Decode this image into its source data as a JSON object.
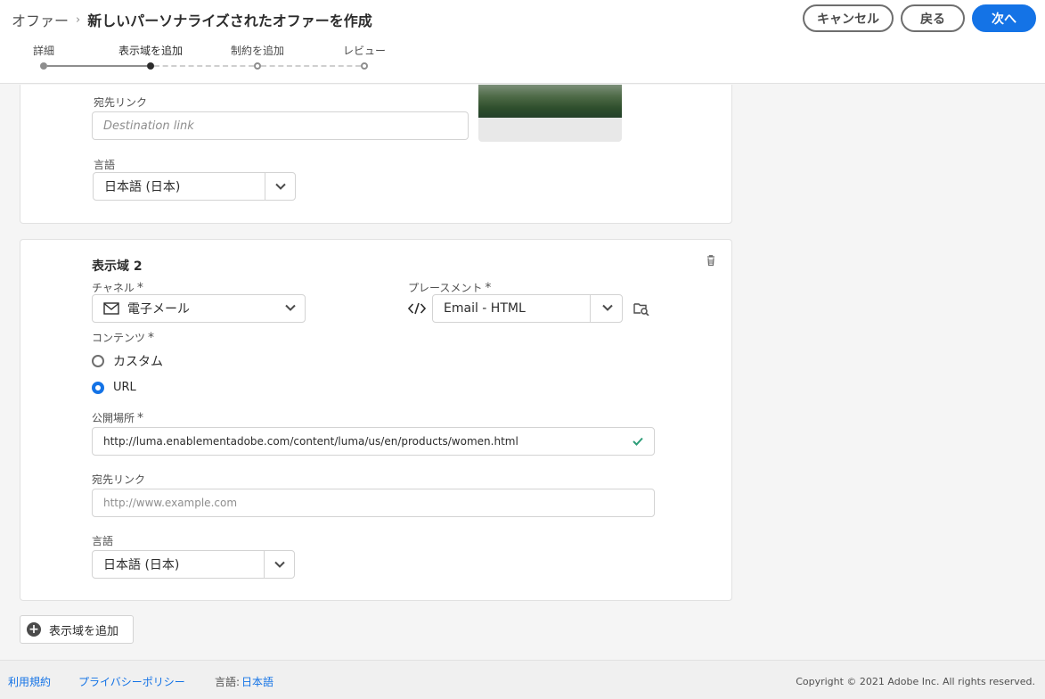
{
  "header": {
    "breadcrumb_root": "オファー",
    "breadcrumb_sep": "›",
    "title": "新しいパーソナライズされたオファーを作成",
    "cancel_label": "キャンセル",
    "back_label": "戻る",
    "next_label": "次へ"
  },
  "steps": [
    {
      "label": "詳細",
      "state": "done"
    },
    {
      "label": "表示域を追加",
      "state": "current"
    },
    {
      "label": "制約を追加",
      "state": "todo"
    },
    {
      "label": "レビュー",
      "state": "todo"
    }
  ],
  "zone1": {
    "destination_label": "宛先リンク",
    "destination_placeholder": "Destination link",
    "language_label": "言語",
    "language_value": "日本語 (日本)"
  },
  "zone2": {
    "title": "表示域 2",
    "channel_label": "チャネル",
    "channel_value": "電子メール",
    "placement_label": "プレースメント",
    "placement_value": "Email - HTML",
    "content_label": "コンテンツ",
    "required_mark": "*",
    "options": [
      "カスタム",
      "URL"
    ],
    "selected_option": "URL",
    "public_location_label": "公開場所",
    "public_location_value": "http://luma.enablementadobe.com/content/luma/us/en/products/women.html",
    "destination_label": "宛先リンク",
    "destination_placeholder": "http://www.example.com",
    "language_label": "言語",
    "language_value": "日本語 (日本)"
  },
  "add_zone_label": "表示域を追加",
  "footer": {
    "terms": "利用規約",
    "privacy": "プライバシーポリシー",
    "language_label": "言語:",
    "language_value": "日本語",
    "copyright": "Copyright © 2021 Adobe Inc. All rights reserved."
  },
  "colors": {
    "accent": "#1473e6",
    "valid_check": "#2d9d78"
  }
}
